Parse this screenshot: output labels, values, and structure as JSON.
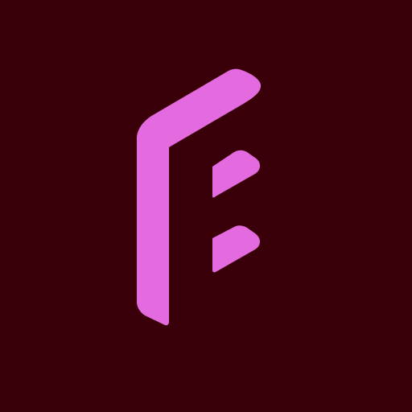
{
  "app_icon": {
    "icon": "letter-f-logo-icon",
    "colors": {
      "background": "#3a0009",
      "glyph": "#e46ae0"
    }
  }
}
